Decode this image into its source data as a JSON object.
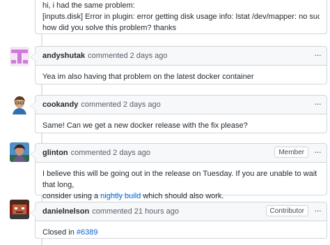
{
  "top_comment": {
    "lines": [
      "hi, i had the same problem:",
      "[inputs.disk] Error in plugin: error getting disk usage info: lstat /dev/mapper: no such file or directory.",
      "how did you solve this problem? thanks"
    ]
  },
  "comments": [
    {
      "author": "andyshutak",
      "time": "commented 2 days ago",
      "badge": "",
      "body": "Yea im also having that problem on the latest docker container"
    },
    {
      "author": "cookandy",
      "time": "commented 2 days ago",
      "badge": "",
      "body": "Same! Can we get a new docker release with the fix please?"
    },
    {
      "author": "glinton",
      "time": "commented 2 days ago",
      "badge": "Member",
      "body_line1": "I believe this will be going out in the release on Tuesday. If you are unable to wait that long,",
      "body_pre_link": "consider using a ",
      "body_link": "nightly build",
      "body_post_link": " which should also work."
    },
    {
      "author": "danielnelson",
      "time": "commented 21 hours ago",
      "badge": "Contributor",
      "body_pre_link": "Closed in ",
      "body_link": "#6389"
    }
  ],
  "icons": {
    "more_actions": "kebab-horizontal-icon"
  },
  "colors": {
    "link": "#0366d6",
    "header_bg": "#f6f8fa",
    "border": "#d1d5da"
  }
}
